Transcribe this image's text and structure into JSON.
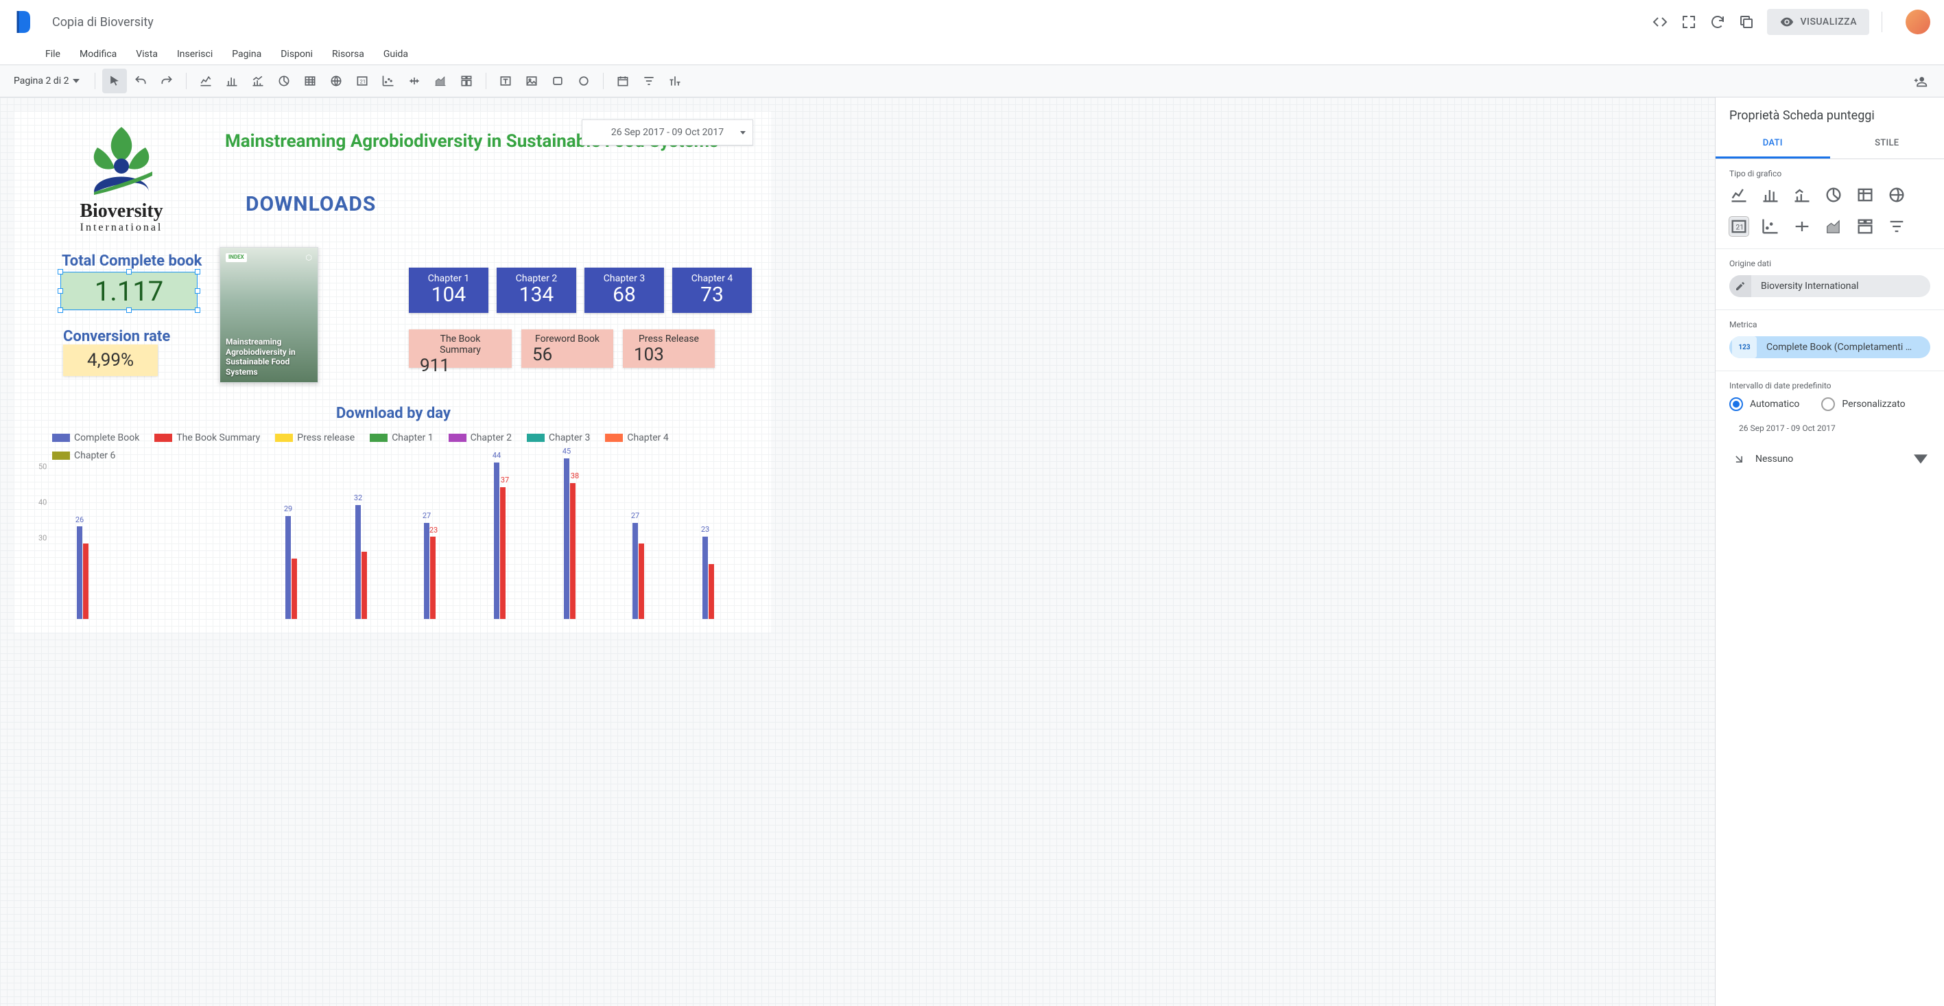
{
  "doc_title": "Copia di Bioversity",
  "menus": [
    "File",
    "Modifica",
    "Vista",
    "Inserisci",
    "Pagina",
    "Disponi",
    "Risorsa",
    "Guida"
  ],
  "top_actions": {
    "view_btn": "VISUALIZZA"
  },
  "page_selector": "Pagina 2 di 2",
  "report": {
    "title": "Mainstreaming Agrobiodiversity in Sustainable Food Systems",
    "downloads_heading": "DOWNLOADS",
    "date_range": "26 Sep 2017 - 09 Oct 2017",
    "logo_name": "Bioversity",
    "logo_sub": "International",
    "kpis": {
      "total_book_label": "Total Complete book",
      "total_book_value": "1.117",
      "conv_label": "Conversion rate",
      "conv_value": "4,99%"
    },
    "book_cover": {
      "title": "Mainstreaming Agrobiodiversity in Sustainable Food Systems",
      "badge": "INDEX"
    },
    "chapters": [
      {
        "label": "Chapter 1",
        "value": "104"
      },
      {
        "label": "Chapter 2",
        "value": "134"
      },
      {
        "label": "Chapter 3",
        "value": "68"
      },
      {
        "label": "Chapter 4",
        "value": "73"
      }
    ],
    "summaries": [
      {
        "label": "The Book Summary",
        "value": "911"
      },
      {
        "label": "Foreword Book",
        "value": "56"
      },
      {
        "label": "Press Release",
        "value": "103"
      }
    ],
    "chart": {
      "title": "Download by day",
      "legend": [
        {
          "name": "Complete Book",
          "color": "#5c6bc0"
        },
        {
          "name": "The Book Summary",
          "color": "#e53935"
        },
        {
          "name": "Press release",
          "color": "#fdd835"
        },
        {
          "name": "Chapter 1",
          "color": "#43a047"
        },
        {
          "name": "Chapter 2",
          "color": "#ab47bc"
        },
        {
          "name": "Chapter 3",
          "color": "#26a69a"
        },
        {
          "name": "Chapter 4",
          "color": "#ff7043"
        },
        {
          "name": "Chapter 6",
          "color": "#9e9d24"
        }
      ],
      "y_ticks": [
        "50",
        "40",
        "30"
      ]
    }
  },
  "chart_data": {
    "type": "bar",
    "title": "Download by day",
    "ylim": [
      0,
      50
    ],
    "series_visible_labels": [
      {
        "series": "Complete Book",
        "values": [
          26,
          29,
          32,
          27,
          44,
          45,
          27,
          23
        ]
      },
      {
        "series": "The Book Summary",
        "values": [
          null,
          null,
          null,
          23,
          37,
          38,
          null,
          null
        ]
      }
    ]
  },
  "panel": {
    "title": "Proprietà Scheda punteggi",
    "tabs": {
      "dati": "DATI",
      "stile": "STILE"
    },
    "sections": {
      "chart_type": "Tipo di grafico",
      "data_source": "Origine dati",
      "data_source_value": "Bioversity International",
      "metric": "Metrica",
      "metric_badge": "123",
      "metric_value": "Complete Book (Completamenti …",
      "date_interval": "Intervallo di date predefinito",
      "radio_auto": "Automatico",
      "radio_custom": "Personalizzato",
      "date_value": "26 Sep 2017 - 09 Oct 2017",
      "drill": "Nessuno"
    }
  }
}
